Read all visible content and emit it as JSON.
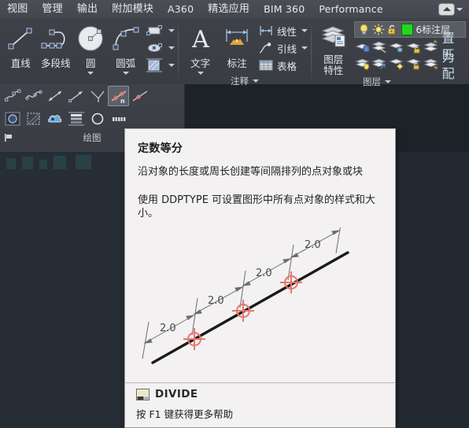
{
  "tabs": [
    {
      "label": "视图",
      "script": "cjk"
    },
    {
      "label": "管理",
      "script": "cjk"
    },
    {
      "label": "输出",
      "script": "cjk"
    },
    {
      "label": "附加模块",
      "script": "cjk"
    },
    {
      "label": "A360",
      "script": "latin"
    },
    {
      "label": "精选应用",
      "script": "cjk"
    },
    {
      "label": "BIM 360",
      "script": "latin"
    },
    {
      "label": "Performance",
      "script": "latin"
    }
  ],
  "ribbon_minimize": {
    "icon": "ribbon-minimize-icon",
    "dropdown_icon": "chevron-down-icon"
  },
  "panels": {
    "draw": {
      "footer": "绘图",
      "big_buttons": [
        {
          "label": "直线",
          "icon": "line-icon",
          "has_caret": false
        },
        {
          "label": "多段线",
          "icon": "polyline-icon",
          "has_caret": false
        },
        {
          "label": "圆",
          "icon": "circle-icon",
          "has_caret": true
        },
        {
          "label": "圆弧",
          "icon": "arc-icon",
          "has_caret": true
        }
      ],
      "small_buttons": [
        {
          "icon": "rectangle-icon",
          "has_caret": true
        },
        {
          "icon": "ellipse-icon",
          "has_caret": true
        },
        {
          "icon": "hatch-icon",
          "has_caret": true
        }
      ],
      "strip_row1": [
        {
          "icon": "spline-cv-icon",
          "selected": false
        },
        {
          "icon": "spline-fit-icon",
          "selected": false
        },
        {
          "icon": "construction-line-icon",
          "selected": false
        },
        {
          "icon": "ray-icon",
          "selected": false
        },
        {
          "icon": "multiline-icon",
          "selected": false
        },
        {
          "icon": "divide-icon",
          "selected": true
        },
        {
          "icon": "measure-icon",
          "selected": false
        }
      ],
      "strip_row2": [
        {
          "icon": "region-icon",
          "selected": false
        },
        {
          "icon": "wipeout-icon",
          "selected": false
        },
        {
          "icon": "revision-cloud-icon",
          "selected": false
        },
        {
          "icon": "gradient-icon",
          "selected": false
        },
        {
          "icon": "donut-icon",
          "selected": false
        },
        {
          "icon": "boundary-icon",
          "selected": false
        }
      ]
    },
    "annotation": {
      "footer": "注释",
      "big_buttons": [
        {
          "label": "文字",
          "icon": "text-icon",
          "has_caret": true
        },
        {
          "label": "标注",
          "icon": "dimension-icon",
          "has_caret": false
        }
      ],
      "small_buttons": [
        {
          "label": "线性",
          "icon": "linear-dimension-icon",
          "has_caret": true
        },
        {
          "label": "引线",
          "icon": "leader-icon",
          "has_caret": true
        },
        {
          "label": "表格",
          "icon": "table-icon",
          "has_caret": false
        }
      ]
    },
    "layers": {
      "footer": "图层",
      "properties_label_line1": "图层",
      "properties_label_line2": "特性",
      "properties_icon": "layer-properties-icon",
      "current_layer": {
        "name": "6标注层",
        "on_icon": "lightbulb-icon",
        "thaw_icon": "sun-icon",
        "lock_icon": "unlocked-padlock-icon",
        "color_swatch": "#1fd81f"
      },
      "row1": [
        {
          "icon": "layer-isolate-icon"
        },
        {
          "icon": "layer-off-icon"
        },
        {
          "icon": "layer-freeze-icon"
        },
        {
          "icon": "layer-lock-icon"
        },
        {
          "icon": "layer-set-current-icon"
        },
        {
          "label": "置为",
          "icon": "set-as-current-icon"
        }
      ],
      "row2": [
        {
          "icon": "layer-on-icon"
        },
        {
          "icon": "layer-unisolate-icon"
        },
        {
          "icon": "layer-thaw-icon"
        },
        {
          "icon": "layer-unlock-icon"
        },
        {
          "icon": "layer-match-icon"
        },
        {
          "label": "匹配",
          "icon": "match-layer-icon"
        }
      ]
    }
  },
  "tooltip": {
    "title": "定数等分",
    "description": "沿对象的长度或周长创建等间隔排列的点对象或块",
    "description2": "使用 DDPTYPE 可设置图形中所有点对象的样式和大小。",
    "command_name": "DIVIDE",
    "command_icon": "divide-command-icon",
    "help_text": "按 F1 键获得更多帮助",
    "illustration": {
      "type": "divide-line-diagram",
      "segment_labels": [
        "2.0",
        "2.0",
        "2.0",
        "2.0"
      ],
      "point_marker_color": "#e8766e",
      "line_color": "#1a1a1a",
      "dimension_color": "#6d6d6d",
      "point_count": 3,
      "segment_count": 4
    }
  }
}
